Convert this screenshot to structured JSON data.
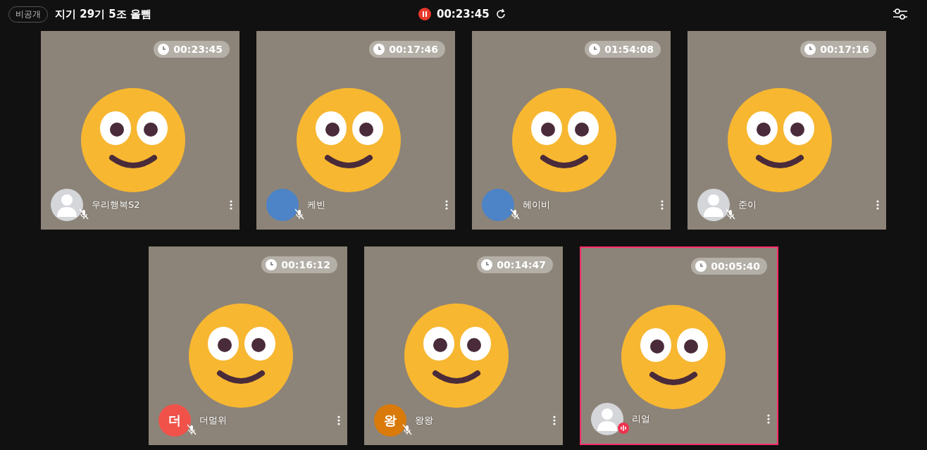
{
  "header": {
    "badge": "비공개",
    "title": "지기 29기 5조 올뺌",
    "elapsed": "00:23:45"
  },
  "rows": [
    [
      {
        "name": "우리행복S2",
        "timer": "00:23:45",
        "avatar": {
          "kind": "default"
        },
        "muted": true,
        "speaking": false
      },
      {
        "name": "케빈",
        "timer": "00:17:46",
        "avatar": {
          "kind": "photo"
        },
        "muted": true,
        "speaking": false
      },
      {
        "name": "헤이비",
        "timer": "01:54:08",
        "avatar": {
          "kind": "photo"
        },
        "muted": true,
        "speaking": false
      },
      {
        "name": "준이",
        "timer": "00:17:16",
        "avatar": {
          "kind": "default"
        },
        "muted": true,
        "speaking": false
      }
    ],
    [
      {
        "name": "더멀위",
        "timer": "00:16:12",
        "avatar": {
          "kind": "letter",
          "letter": "더",
          "color": "#f0524a"
        },
        "muted": true,
        "speaking": false
      },
      {
        "name": "왕왕",
        "timer": "00:14:47",
        "avatar": {
          "kind": "letter",
          "letter": "왕",
          "color": "#d97a0a"
        },
        "muted": true,
        "speaking": false
      },
      {
        "name": "리얼",
        "timer": "00:05:40",
        "avatar": {
          "kind": "default"
        },
        "muted": false,
        "speaking": true
      }
    ]
  ]
}
